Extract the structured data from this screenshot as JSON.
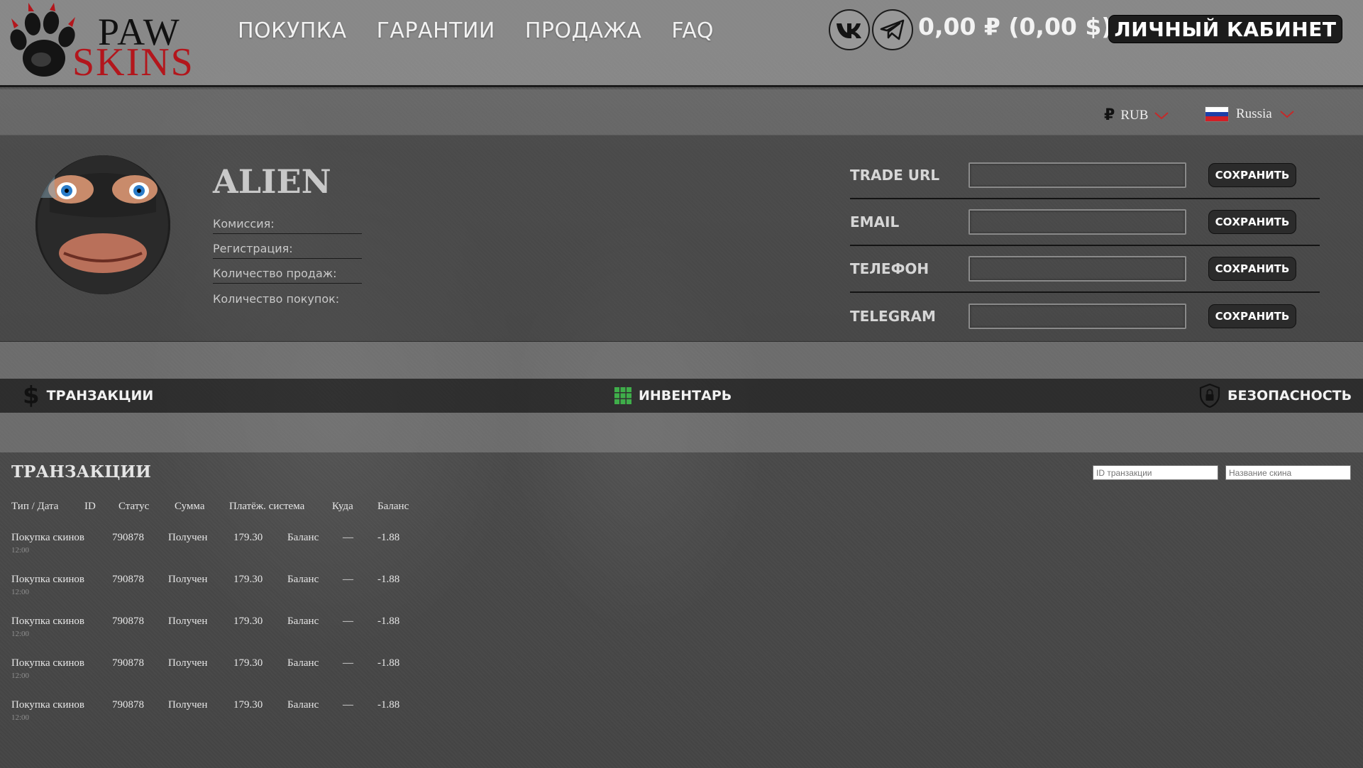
{
  "header": {
    "logo_line1": "PAW",
    "logo_line2": "SKINS",
    "nav": [
      "ПОКУПКА",
      "ГАРАНТИИ",
      "ПРОДАЖА",
      "FAQ"
    ],
    "balance": "0,00 ₽ (0,00 $)",
    "cabinet_label": "ЛИЧНЫЙ КАБИНЕТ"
  },
  "settings": {
    "currency_symbol": "₽",
    "currency": "RUB",
    "language": "Russia"
  },
  "profile": {
    "username": "ALIEN",
    "stats": [
      "Комиссия:",
      "Регистрация:",
      "Количество продаж:",
      "Количество покупок:"
    ],
    "fields": [
      {
        "label": "TRADE URL",
        "value": "",
        "button": "СОХРАНИТЬ"
      },
      {
        "label": "EMAIL",
        "value": "",
        "button": "СОХРАНИТЬ"
      },
      {
        "label": "ТЕЛЕФОН",
        "value": "",
        "button": "СОХРАНИТЬ"
      },
      {
        "label": "TELEGRAM",
        "value": "",
        "button": "СОХРАНИТЬ"
      }
    ]
  },
  "tabs": [
    "ТРАНЗАКЦИИ",
    "ИНВЕНТАРЬ",
    "БЕЗОПАСНОСТЬ"
  ],
  "transactions": {
    "title": "ТРАНЗАКЦИИ",
    "search_id_placeholder": "ID транзакции",
    "search_skin_placeholder": "Название скина",
    "columns": [
      "Тип / Дата",
      "ID",
      "Статус",
      "Сумма",
      "Платёж. система",
      "Куда",
      "Баланс"
    ],
    "rows": [
      {
        "type": "Покупка скинов",
        "time": "12:00",
        "id": "790878",
        "status": "Получен",
        "amount": "179.30",
        "system": "Баланс",
        "dest": "—",
        "balance": "-1.88"
      },
      {
        "type": "Покупка скинов",
        "time": "12:00",
        "id": "790878",
        "status": "Получен",
        "amount": "179.30",
        "system": "Баланс",
        "dest": "—",
        "balance": "-1.88"
      },
      {
        "type": "Покупка скинов",
        "time": "12:00",
        "id": "790878",
        "status": "Получен",
        "amount": "179.30",
        "system": "Баланс",
        "dest": "—",
        "balance": "-1.88"
      },
      {
        "type": "Покупка скинов",
        "time": "12:00",
        "id": "790878",
        "status": "Получен",
        "amount": "179.30",
        "system": "Баланс",
        "dest": "—",
        "balance": "-1.88"
      },
      {
        "type": "Покупка скинов",
        "time": "12:00",
        "id": "790878",
        "status": "Получен",
        "amount": "179.30",
        "system": "Баланс",
        "dest": "—",
        "balance": "-1.88"
      }
    ]
  },
  "colors": {
    "logo_red": "#b3161c",
    "inventory_green": "#3fae4a",
    "flag_white": "#ffffff",
    "flag_blue": "#1c3fa8",
    "flag_red": "#d21f26"
  },
  "icons": [
    "paw-logo-icon",
    "vk-icon",
    "telegram-icon",
    "ruble-icon",
    "chevron-down-icon",
    "russia-flag-icon",
    "dollar-icon",
    "grid-icon",
    "shield-lock-icon"
  ]
}
